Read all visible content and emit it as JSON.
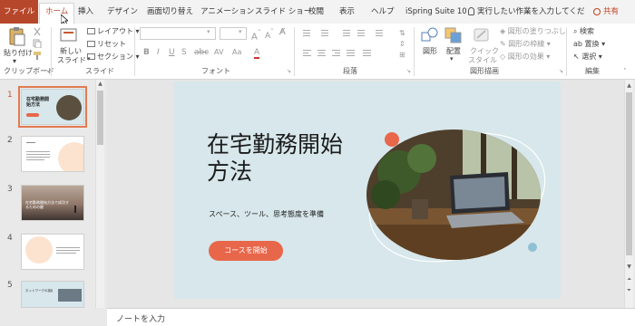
{
  "tabs": {
    "file": "ファイル",
    "home": "ホーム",
    "insert": "挿入",
    "design": "デザイン",
    "transitions": "画面切り替え",
    "animations": "アニメーション",
    "slideshow": "スライド ショー",
    "review": "校閲",
    "view": "表示",
    "help": "ヘルプ",
    "ispring": "iSpring Suite 10",
    "tellme": "実行したい作業を入力してくだ",
    "share": "共有"
  },
  "ribbon": {
    "clipboard": {
      "paste": "貼り付け",
      "label": "クリップボード"
    },
    "slides": {
      "new_slide_1": "新しい",
      "new_slide_2": "スライド",
      "layout": "レイアウト",
      "reset": "リセット",
      "section": "セクション",
      "label": "スライド"
    },
    "font": {
      "label": "フォント"
    },
    "paragraph": {
      "label": "段落"
    },
    "drawing": {
      "shapes": "図形",
      "arrange": "配置",
      "quick_style_1": "クイック",
      "quick_style_2": "スタイル",
      "fill": "図形の塗りつぶし",
      "outline": "図形の枠線",
      "effects": "図形の効果",
      "label": "図形描画"
    },
    "editing": {
      "find": "検索",
      "replace": "置換",
      "select": "選択",
      "label": "編集"
    }
  },
  "thumbnails": [
    {
      "number": "1",
      "title": "在宅勤務開始方法"
    },
    {
      "number": "2"
    },
    {
      "number": "3",
      "title": "在宅勤務開始方法で成功するための鍵"
    },
    {
      "number": "4"
    },
    {
      "number": "5",
      "title": "ネットワークの接続"
    }
  ],
  "slide": {
    "title": "在宅勤務開始方法",
    "subtitle": "スペース、ツール、思考態度を準備",
    "button": "コースを開始"
  },
  "notes": {
    "placeholder": "ノートを入力"
  },
  "colors": {
    "accent": "#b7472a",
    "slide_bg": "#d7e7eb",
    "cta": "#e8674a"
  }
}
